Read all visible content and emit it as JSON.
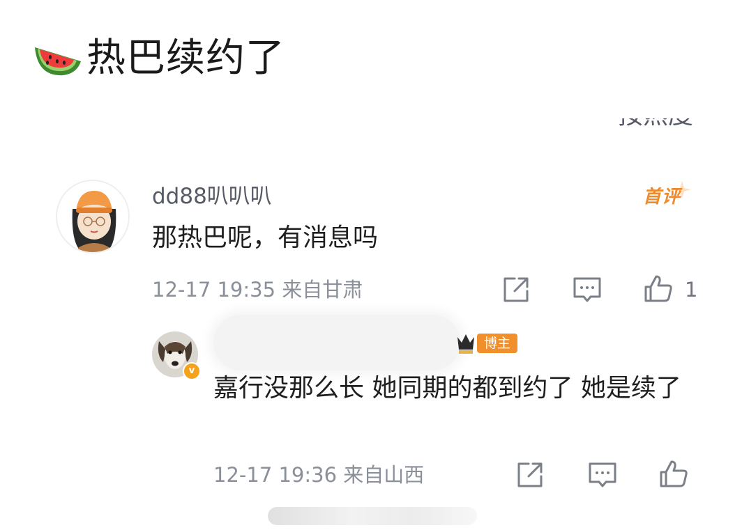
{
  "post": {
    "title": "热巴续约了",
    "title_icon": "watermelon-emoji",
    "top_partial_text": "一 按热度"
  },
  "comment": {
    "username": "dd88叭叭叭",
    "badge": "首评",
    "text": "那热巴呢，有消息吗",
    "timestamp": "12-17 19:35",
    "location": "来自甘肃",
    "like_count": "1",
    "actions": [
      "share-icon",
      "comment-icon",
      "like-icon"
    ]
  },
  "reply": {
    "username_redacted": true,
    "badge": "博主",
    "verified_icon": "v",
    "text": "嘉行没那么长 她同期的都到约了 她是续了",
    "timestamp": "12-17 19:36",
    "location": "来自山西",
    "actions": [
      "share-icon",
      "comment-icon",
      "like-icon"
    ]
  },
  "colors": {
    "accent_orange": "#f28f2d",
    "meta_gray": "#8a8f99",
    "text_dark": "#1f1f1f"
  }
}
